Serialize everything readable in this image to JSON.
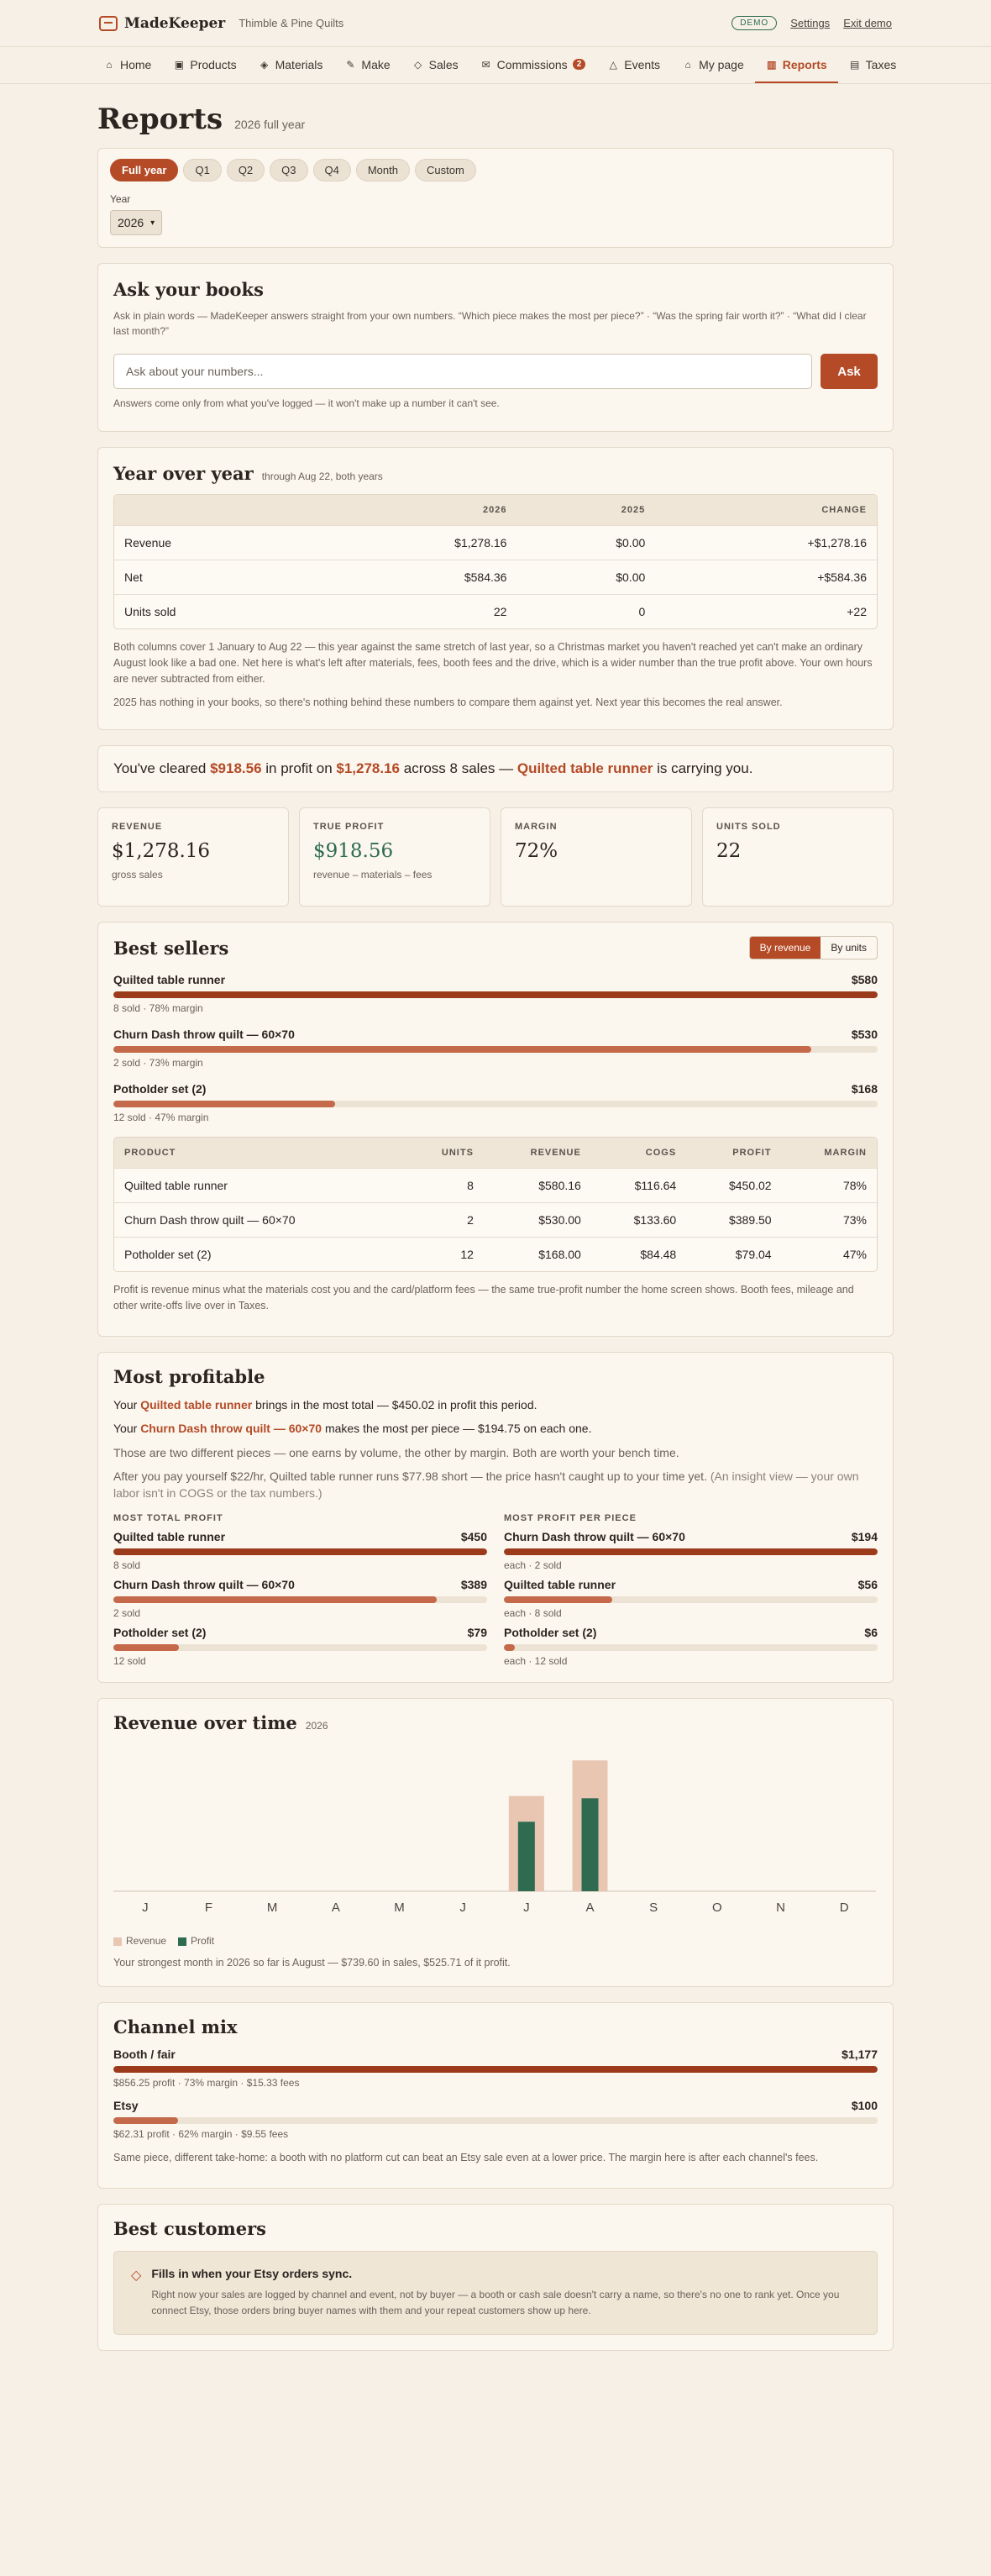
{
  "app": {
    "name": "MadeKeeper",
    "shop": "Thimble & Pine Quilts",
    "demo_label": "DEMO",
    "settings": "Settings",
    "exit": "Exit demo"
  },
  "nav": [
    {
      "label": "Home",
      "icon": "home-icon",
      "glyph": "⌂"
    },
    {
      "label": "Products",
      "icon": "box-icon",
      "glyph": "▣"
    },
    {
      "label": "Materials",
      "icon": "layers-icon",
      "glyph": "◈"
    },
    {
      "label": "Make",
      "icon": "hammer-icon",
      "glyph": "✎"
    },
    {
      "label": "Sales",
      "icon": "tag-icon",
      "glyph": "◇"
    },
    {
      "label": "Commissions",
      "icon": "mail-icon",
      "glyph": "✉",
      "badge": "2"
    },
    {
      "label": "Events",
      "icon": "tent-icon",
      "glyph": "△"
    },
    {
      "label": "My page",
      "icon": "store-icon",
      "glyph": "⌂"
    },
    {
      "label": "Reports",
      "icon": "chart-icon",
      "glyph": "▥",
      "active": true
    },
    {
      "label": "Taxes",
      "icon": "document-icon",
      "glyph": "▤"
    }
  ],
  "page": {
    "title": "Reports",
    "subtitle": "2026 full year"
  },
  "period": {
    "pills": [
      "Full year",
      "Q1",
      "Q2",
      "Q3",
      "Q4",
      "Month",
      "Custom"
    ],
    "active": "Full year",
    "year_label": "Year",
    "year_value": "2026"
  },
  "ask": {
    "title": "Ask your books",
    "description": "Ask in plain words — MadeKeeper answers straight from your own numbers. “Which piece makes the most per piece?” · “Was the spring fair worth it?” · “What did I clear last month?”",
    "placeholder": "Ask about your numbers...",
    "button": "Ask",
    "footnote": "Answers come only from what you've logged — it won't make up a number it can't see."
  },
  "yoy": {
    "title": "Year over year",
    "subtitle": "through Aug 22, both years",
    "headers": [
      "",
      "2026",
      "2025",
      "CHANGE"
    ],
    "rows": [
      [
        "Revenue",
        "$1,278.16",
        "$0.00",
        "+$1,278.16"
      ],
      [
        "Net",
        "$584.36",
        "$0.00",
        "+$584.36"
      ],
      [
        "Units sold",
        "22",
        "0",
        "+22"
      ]
    ],
    "note1": "Both columns cover 1 January to Aug 22 — this year against the same stretch of last year, so a Christmas market you haven't reached yet can't make an ordinary August look like a bad one. Net here is what's left after materials, fees, booth fees and the drive, which is a wider number than the true profit above. Your own hours are never subtracted from either.",
    "note2": "2025 has nothing in your books, so there's nothing behind these numbers to compare them against yet. Next year this becomes the real answer."
  },
  "headline": {
    "p1": "You've cleared ",
    "profit": "$918.56",
    "p2": " in profit on ",
    "revenue": "$1,278.16",
    "p3": " across 8 sales — ",
    "product": "Quilted table runner",
    "p4": " is carrying you."
  },
  "kpis": [
    {
      "label": "REVENUE",
      "value": "$1,278.16",
      "sub": "gross sales"
    },
    {
      "label": "TRUE PROFIT",
      "value": "$918.56",
      "sub": "revenue – materials – fees",
      "green": true
    },
    {
      "label": "MARGIN",
      "value": "72%",
      "sub": ""
    },
    {
      "label": "UNITS SOLD",
      "value": "22",
      "sub": ""
    }
  ],
  "best_sellers": {
    "title": "Best sellers",
    "toggle": [
      "By revenue",
      "By units"
    ],
    "bars": [
      {
        "name": "Quilted table runner",
        "value": "$580",
        "sub": "8 sold · 78% margin",
        "frac": 1.0,
        "tone": "dark"
      },
      {
        "name": "Churn Dash throw quilt — 60×70",
        "value": "$530",
        "sub": "2 sold · 73% margin",
        "frac": 0.913,
        "tone": "mid"
      },
      {
        "name": "Potholder set (2)",
        "value": "$168",
        "sub": "12 sold · 47% margin",
        "frac": 0.29,
        "tone": "mid"
      }
    ],
    "headers": [
      "PRODUCT",
      "UNITS",
      "REVENUE",
      "COGS",
      "PROFIT",
      "MARGIN"
    ],
    "rows": [
      [
        "Quilted table runner",
        "8",
        "$580.16",
        "$116.64",
        "$450.02",
        "78%"
      ],
      [
        "Churn Dash throw quilt — 60×70",
        "2",
        "$530.00",
        "$133.60",
        "$389.50",
        "73%"
      ],
      [
        "Potholder set (2)",
        "12",
        "$168.00",
        "$84.48",
        "$79.04",
        "47%"
      ]
    ],
    "note": "Profit is revenue minus what the materials cost you and the card/platform fees — the same true-profit number the home screen shows. Booth fees, mileage and other write-offs live over in Taxes."
  },
  "most_profitable": {
    "title": "Most profitable",
    "l1a": "Your ",
    "l1b": "Quilted table runner",
    "l1c": " brings in the most total — $450.02 in profit this period.",
    "l2a": "Your ",
    "l2b": "Churn Dash throw quilt — 60×70",
    "l2c": " makes the most per piece — $194.75 on each one.",
    "l3": "Those are two different pieces — one earns by volume, the other by margin. Both are worth your bench time.",
    "l4": "After you pay yourself $22/hr, Quilted table runner runs $77.98 short — the price hasn't caught up to your time yet.",
    "l4b": " (An insight view — your own labor isn't in COGS or the tax numbers.)",
    "total_head": "MOST TOTAL PROFIT",
    "per_head": "MOST PROFIT PER PIECE",
    "total": [
      {
        "name": "Quilted table runner",
        "value": "$450",
        "sub": "8 sold",
        "frac": 1.0,
        "tone": "dark"
      },
      {
        "name": "Churn Dash throw quilt — 60×70",
        "value": "$389",
        "sub": "2 sold",
        "frac": 0.865,
        "tone": "mid"
      },
      {
        "name": "Potholder set (2)",
        "value": "$79",
        "sub": "12 sold",
        "frac": 0.175,
        "tone": "mid"
      }
    ],
    "per": [
      {
        "name": "Churn Dash throw quilt — 60×70",
        "value": "$194",
        "sub": "each · 2 sold",
        "frac": 1.0,
        "tone": "dark"
      },
      {
        "name": "Quilted table runner",
        "value": "$56",
        "sub": "each · 8 sold",
        "frac": 0.29,
        "tone": "mid"
      },
      {
        "name": "Potholder set (2)",
        "value": "$6",
        "sub": "each · 12 sold",
        "frac": 0.03,
        "tone": "mid"
      }
    ]
  },
  "revenue_chart": {
    "title": "Revenue over time",
    "year": "2026",
    "note": "Your strongest month in 2026 so far is August — $739.60 in sales, $525.71 of it profit.",
    "legend": [
      "Revenue",
      "Profit"
    ]
  },
  "chart_data": {
    "type": "bar",
    "title": "Revenue over time",
    "categories": [
      "J",
      "F",
      "M",
      "A",
      "M",
      "J",
      "J",
      "A",
      "S",
      "O",
      "N",
      "D"
    ],
    "series": [
      {
        "name": "Revenue",
        "values": [
          0,
          0,
          0,
          0,
          0,
          0,
          538.56,
          739.6,
          0,
          0,
          0,
          0
        ],
        "color": "#e8c6b2"
      },
      {
        "name": "Profit",
        "values": [
          0,
          0,
          0,
          0,
          0,
          0,
          392.85,
          525.71,
          0,
          0,
          0,
          0
        ],
        "color": "#2e6b50"
      }
    ],
    "ylim": [
      0,
      760
    ],
    "grid": false,
    "legend": "bottom-left"
  },
  "channel": {
    "title": "Channel mix",
    "bars": [
      {
        "name": "Booth / fair",
        "value": "$1,177",
        "sub": "$856.25 profit · 73% margin · $15.33 fees",
        "frac": 1.0,
        "tone": "dark"
      },
      {
        "name": "Etsy",
        "value": "$100",
        "sub": "$62.31 profit · 62% margin · $9.55 fees",
        "frac": 0.085,
        "tone": "mid"
      }
    ],
    "note": "Same piece, different take-home: a booth with no platform cut can beat an Etsy sale even at a lower price. The margin here is after each channel's fees."
  },
  "customers": {
    "title": "Best customers",
    "empty_title": "Fills in when your Etsy orders sync.",
    "empty_body": "Right now your sales are logged by channel and event, not by buyer — a booth or cash sale doesn't carry a name, so there's no one to rank yet. Once you connect Etsy, those orders bring buyer names with them and your repeat customers show up here."
  },
  "colors": {
    "accent": "#b44a26",
    "bar_dark": "#9b3b1c",
    "bar_mid": "#c4694a",
    "green": "#2e6b50",
    "revenue_bar": "#e8c6b2"
  }
}
